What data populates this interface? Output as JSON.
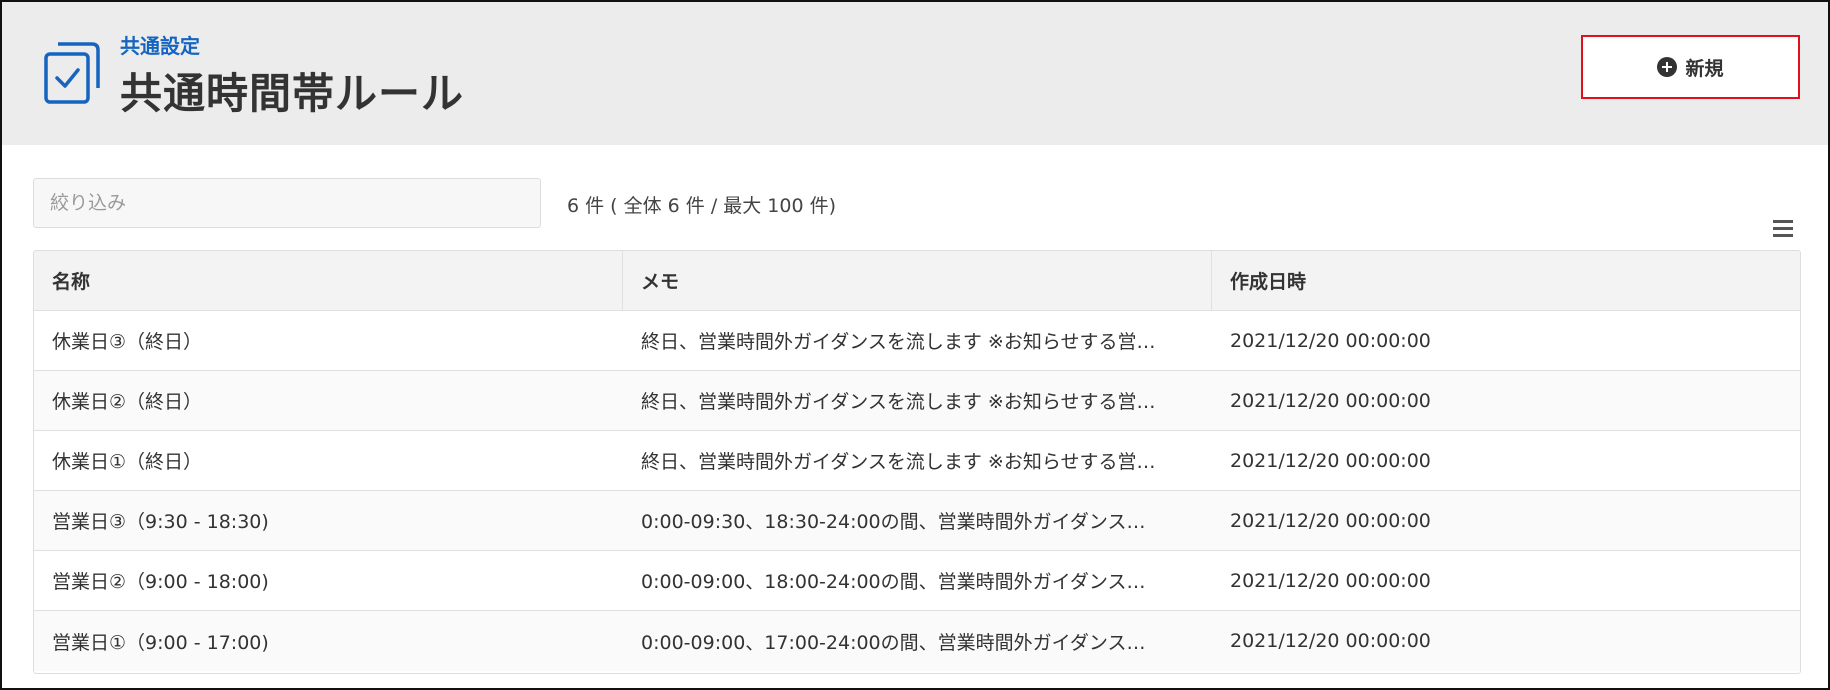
{
  "header": {
    "breadcrumb": "共通設定",
    "title": "共通時間帯ルール",
    "new_button_label": "新規"
  },
  "filter": {
    "placeholder": "絞り込み",
    "value": ""
  },
  "count_text": "6 件 ( 全体 6 件 / 最大 100 件)",
  "table": {
    "columns": [
      "名称",
      "メモ",
      "作成日時"
    ],
    "rows": [
      {
        "name": "休業日③（終日）",
        "memo": "終日、営業時間外ガイダンスを流します ※お知らせする営…",
        "created": "2021/12/20 00:00:00"
      },
      {
        "name": "休業日②（終日）",
        "memo": "終日、営業時間外ガイダンスを流します ※お知らせする営…",
        "created": "2021/12/20 00:00:00"
      },
      {
        "name": "休業日①（終日）",
        "memo": "終日、営業時間外ガイダンスを流します ※お知らせする営…",
        "created": "2021/12/20 00:00:00"
      },
      {
        "name": "営業日③（9:30 - 18:30)",
        "memo": "0:00-09:30、18:30-24:00の間、営業時間外ガイダンス…",
        "created": "2021/12/20 00:00:00"
      },
      {
        "name": "営業日②（9:00 - 18:00)",
        "memo": "0:00-09:00、18:00-24:00の間、営業時間外ガイダンス…",
        "created": "2021/12/20 00:00:00"
      },
      {
        "name": "営業日①（9:00 - 17:00)",
        "memo": "0:00-09:00、17:00-24:00の間、営業時間外ガイダンス…",
        "created": "2021/12/20 00:00:00"
      }
    ]
  },
  "colors": {
    "accent": "#1565c0",
    "highlight_border": "#e0101c",
    "header_bg": "#ececec"
  },
  "icons": {
    "page": "checklist-icon",
    "new": "plus-circle-icon",
    "menu": "hamburger-menu-icon"
  }
}
